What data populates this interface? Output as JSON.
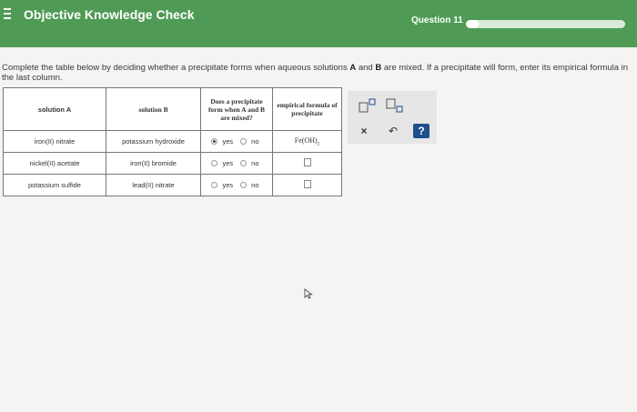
{
  "header": {
    "title": "Objective Knowledge Check",
    "question_label": "Question 11",
    "progress": 0.08
  },
  "instructions": {
    "part1": "Complete the table below by deciding whether a precipitate forms when aqueous solutions ",
    "a": "A",
    "and": " and ",
    "b": "B",
    "part2": " are mixed. If a precipitate will form, enter its empirical formula in the last column."
  },
  "table": {
    "headers": {
      "solution_a": "solution A",
      "solution_b": "solution B",
      "precipitate": "Does a precipitate form when A and B are mixed?",
      "formula": "empirical formula of precipitate"
    },
    "rows": [
      {
        "a": "iron(II) nitrate",
        "b": "potassium hydroxide",
        "selected": "yes",
        "formula_base": "Fe(OH)",
        "formula_sub": "2"
      },
      {
        "a": "nickel(II) acetate",
        "b": "iron(II) bromide",
        "selected": "none",
        "formula_base": "",
        "formula_sub": ""
      },
      {
        "a": "potassium sulfide",
        "b": "lead(II) nitrate",
        "selected": "none",
        "formula_base": "",
        "formula_sub": ""
      }
    ],
    "yes_label": "yes",
    "no_label": "no"
  },
  "palette": {
    "superscript_icon": "superscript-icon",
    "subscript_icon": "subscript-icon",
    "clear": "×",
    "undo": "↶",
    "help": "?"
  },
  "colors": {
    "header_green": "#4f9b55",
    "help_blue": "#1e4f8c"
  }
}
